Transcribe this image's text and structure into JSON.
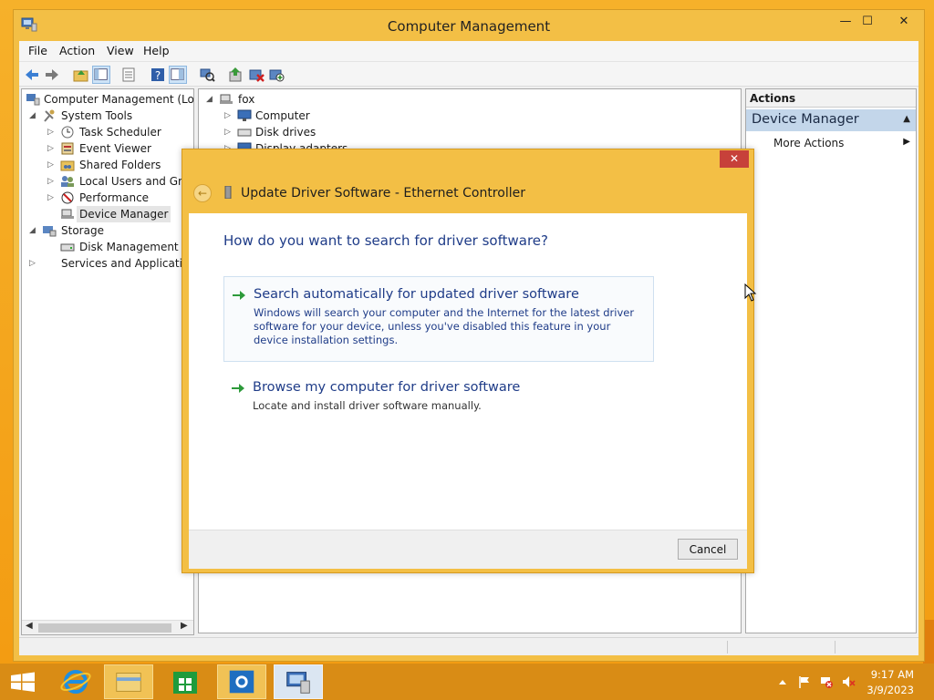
{
  "window": {
    "title": "Computer Management",
    "minimize_glyph": "—",
    "maximize_glyph": "☐",
    "close_glyph": "✕"
  },
  "menu": [
    "File",
    "Action",
    "View",
    "Help"
  ],
  "tree": {
    "items": [
      {
        "label": "Computer Management (Local"
      },
      {
        "label": "System Tools"
      },
      {
        "label": "Task Scheduler"
      },
      {
        "label": "Event Viewer"
      },
      {
        "label": "Shared Folders"
      },
      {
        "label": "Local Users and Group"
      },
      {
        "label": "Performance"
      },
      {
        "label": "Device Manager"
      },
      {
        "label": "Storage"
      },
      {
        "label": "Disk Management"
      },
      {
        "label": "Services and Applications"
      }
    ]
  },
  "devices": {
    "root": "fox",
    "items": [
      {
        "label": "Computer"
      },
      {
        "label": "Disk drives"
      },
      {
        "label": "Display adapters"
      }
    ]
  },
  "actions": {
    "header": "Actions",
    "section": "Device Manager",
    "more": "More Actions"
  },
  "dialog": {
    "title": "Update Driver Software - Ethernet Controller",
    "question": "How do you want to search for driver software?",
    "option_auto": {
      "title": "Search automatically for updated driver software",
      "desc": "Windows will search your computer and the Internet for the latest driver software for your device, unless you've disabled this feature in your device installation settings."
    },
    "option_browse": {
      "title": "Browse my computer for driver software",
      "desc": "Locate and install driver software manually."
    },
    "cancel_label": "Cancel"
  },
  "taskbar": {
    "time": "9:17 AM",
    "date": "3/9/2023"
  },
  "colors": {
    "accent_title": "#1f3c88",
    "window_frame": "#f3bf45",
    "taskbar": "#d98c15",
    "dialog_close": "#c7413a"
  }
}
